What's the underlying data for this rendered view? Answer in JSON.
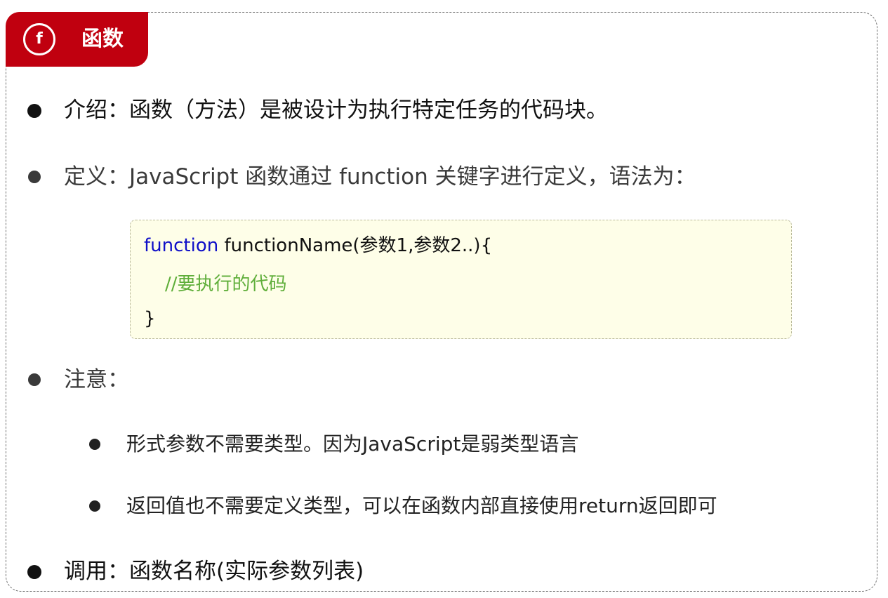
{
  "header": {
    "icon_glyph": "f",
    "icon_name": "function-icon",
    "title": "函数",
    "background_color": "#c0000f"
  },
  "items": [
    {
      "text": "介绍：函数（方法）是被设计为执行特定任务的代码块。"
    },
    {
      "text": "定义：JavaScript 函数通过 function 关键字进行定义，语法为："
    },
    {
      "text": "注意："
    },
    {
      "text": "调用：函数名称(实际参数列表)"
    }
  ],
  "code": {
    "keyword": "function",
    "line1_rest": " functionName(参数1,参数2..){",
    "comment": "//要执行的代码",
    "closing": "}",
    "keyword_color": "#1010c8",
    "comment_color": "#5fae3a",
    "background_color": "#fefee8"
  },
  "notes": [
    {
      "text": "形式参数不需要类型。因为JavaScript是弱类型语言"
    },
    {
      "text": "返回值也不需要定义类型，可以在函数内部直接使用return返回即可"
    }
  ]
}
